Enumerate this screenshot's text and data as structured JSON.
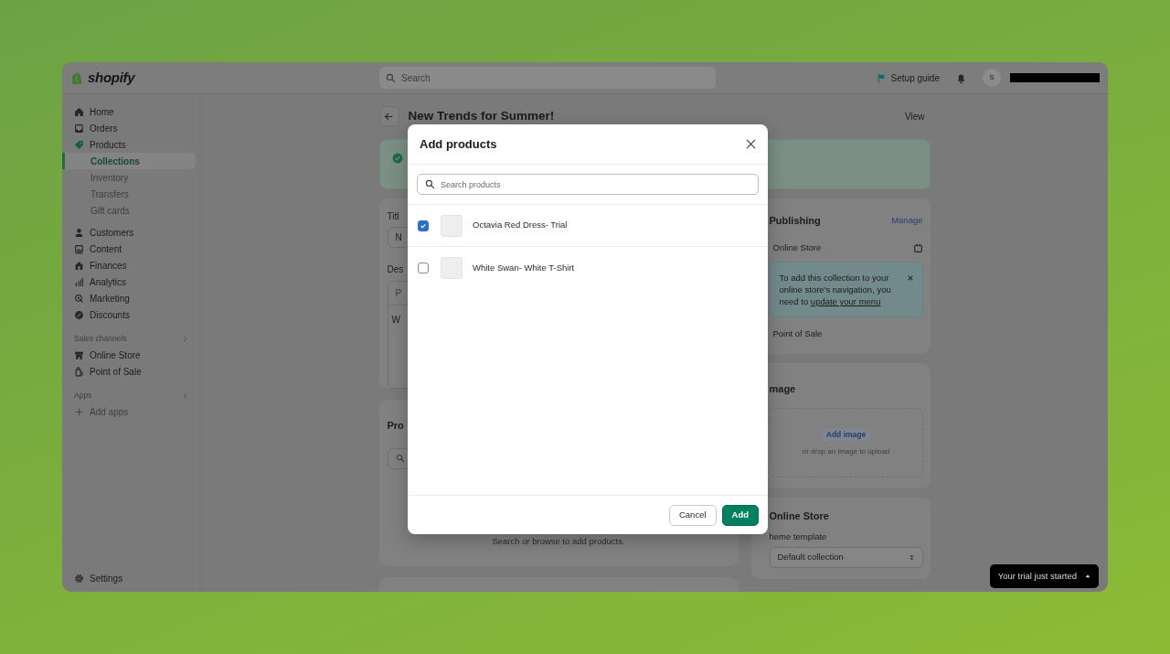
{
  "topbar": {
    "logo": "shopify",
    "search": {
      "placeholder": "Search"
    },
    "setup_guide": "Setup guide",
    "avatar": "S"
  },
  "sidebar": {
    "items": [
      {
        "label": "Home",
        "selected": false
      },
      {
        "label": "Orders",
        "selected": false
      },
      {
        "label": "Products",
        "selected": false,
        "children": [
          {
            "label": "Collections",
            "selected": true
          },
          {
            "label": "Inventory",
            "selected": false
          },
          {
            "label": "Transfers",
            "selected": false
          },
          {
            "label": "Gift cards",
            "selected": false
          }
        ]
      },
      {
        "label": "Customers",
        "selected": false
      },
      {
        "label": "Content",
        "selected": false
      },
      {
        "label": "Finances",
        "selected": false
      },
      {
        "label": "Analytics",
        "selected": false
      },
      {
        "label": "Marketing",
        "selected": false
      },
      {
        "label": "Discounts",
        "selected": false
      }
    ],
    "sections": [
      {
        "title": "Sales channels",
        "items": [
          {
            "label": "Online Store",
            "selected": false
          },
          {
            "label": "Point of Sale",
            "selected": false
          }
        ]
      },
      {
        "title": "Apps",
        "items": [
          {
            "label": "Add apps",
            "selected": false
          }
        ]
      }
    ],
    "settings": "Settings"
  },
  "page": {
    "title": "New Trends for Summer!",
    "view": "View",
    "details": {
      "title_label": "Titl",
      "title_value": "N",
      "description_label": "Des",
      "editor_toolbar": "P",
      "editor_text": "W"
    },
    "products": {
      "heading": "Pro",
      "empty": "Search or browse to add products."
    },
    "publishing": {
      "title": "Publishing",
      "action": "Manage",
      "channels": [
        {
          "name": "Online Store",
          "notice": {
            "text": "To add this collection to your online store's navigation, you need to ",
            "link": "update your menu"
          }
        },
        {
          "name": "Point of Sale"
        }
      ]
    },
    "image": {
      "title": "mage",
      "button": "Add image",
      "hint": "or drop an image to upload"
    },
    "online_store": {
      "title": "Online Store",
      "template_label": "heme template",
      "template_value": "Default collection"
    }
  },
  "modal": {
    "title": "Add products",
    "search": {
      "placeholder": "Search products"
    },
    "products": [
      {
        "name": "Octavia Red Dress- Trial",
        "checked": true
      },
      {
        "name": "White Swan- White T-Shirt",
        "checked": false
      }
    ],
    "buttons": [
      {
        "label": "Cancel",
        "kind": "secondary"
      },
      {
        "label": "Add",
        "kind": "primary"
      }
    ]
  },
  "toast": {
    "text": "Your trial just started"
  }
}
